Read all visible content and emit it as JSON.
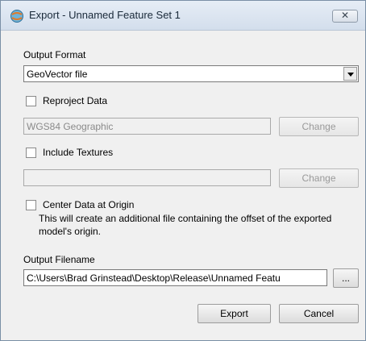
{
  "window": {
    "title": "Export - Unnamed Feature Set 1",
    "close_glyph": "✕"
  },
  "output_format": {
    "label": "Output Format",
    "selected": "GeoVector file"
  },
  "reproject": {
    "label": "Reproject Data",
    "checked": false,
    "value": "WGS84 Geographic",
    "change_label": "Change"
  },
  "textures": {
    "label": "Include Textures",
    "checked": false,
    "value": "",
    "change_label": "Change"
  },
  "center": {
    "label": "Center Data at Origin",
    "checked": false,
    "description": "This will create an additional file containing the offset of the exported model's origin."
  },
  "output_filename": {
    "label": "Output Filename",
    "value": "C:\\Users\\Brad Grinstead\\Desktop\\Release\\Unnamed Featu",
    "browse_label": "..."
  },
  "buttons": {
    "export": "Export",
    "cancel": "Cancel"
  },
  "icons": {
    "app": "export-globe-icon",
    "close": "close-icon",
    "dropdown": "chevron-down-icon"
  }
}
